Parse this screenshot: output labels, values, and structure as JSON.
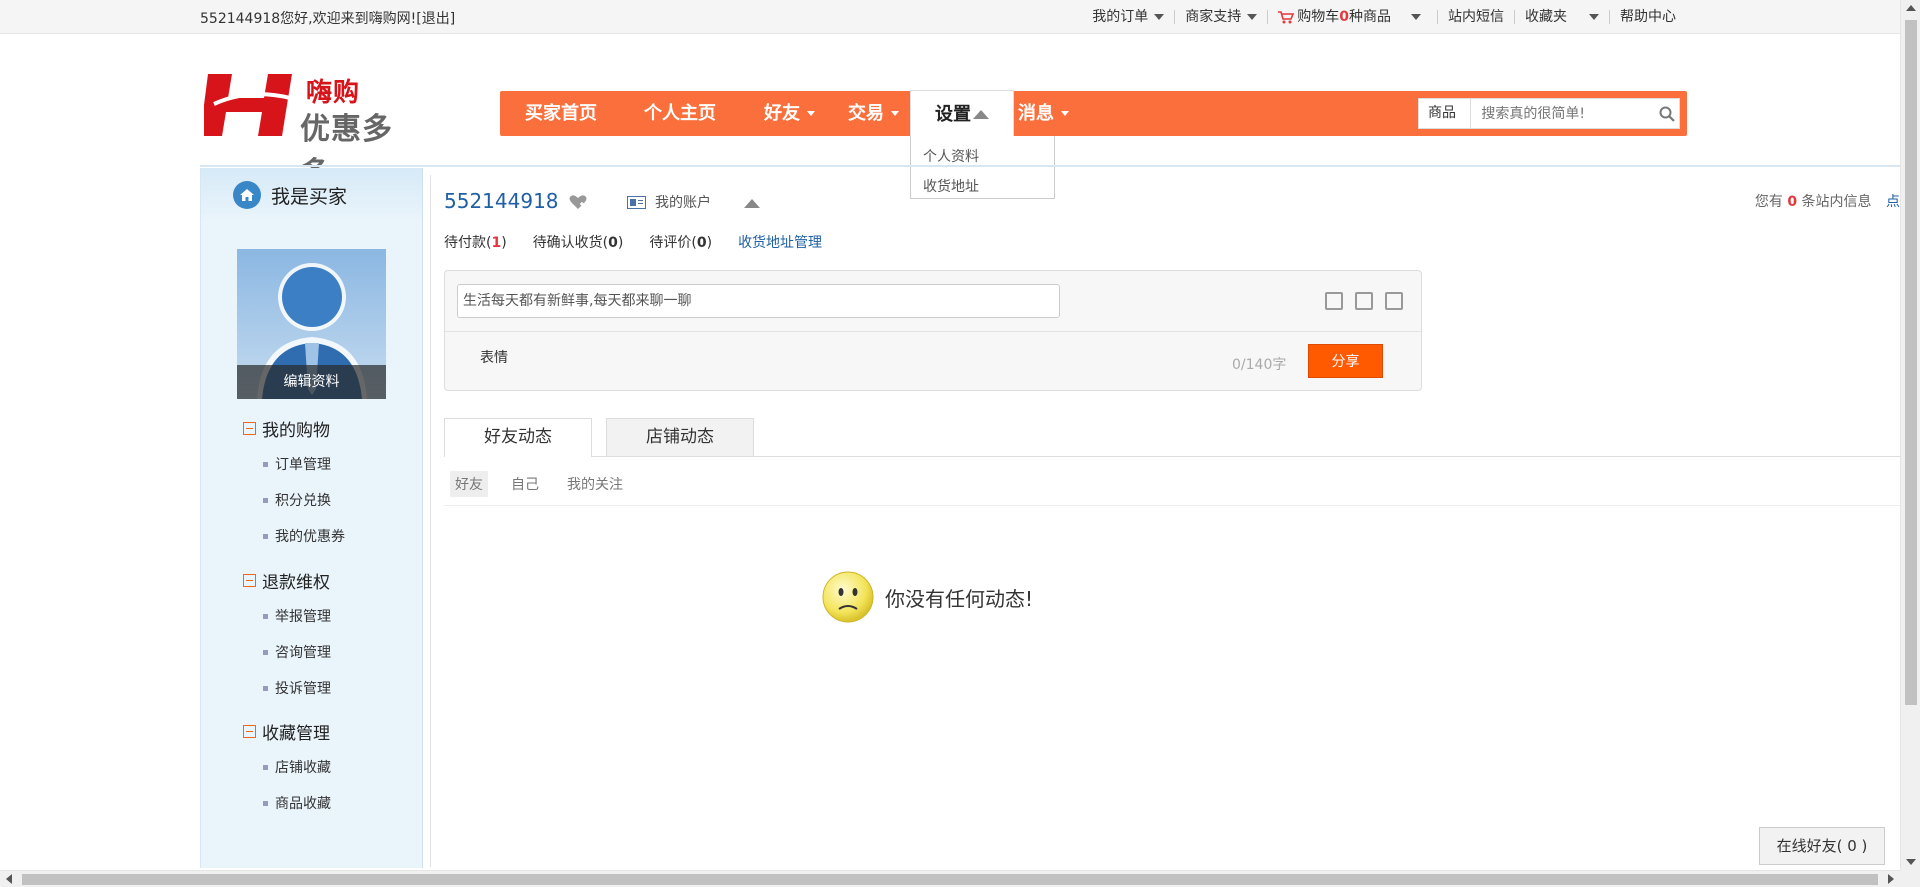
{
  "topbar": {
    "welcome": "552144918您好,欢迎来到嗨购网!",
    "logout": "[退出]",
    "my_orders": "我的订单",
    "seller_support": "商家支持",
    "cart_prefix": "购物车",
    "cart_count": "0",
    "cart_suffix": "种商品",
    "site_msg": "站内短信",
    "favorites": "收藏夹",
    "help": "帮助中心"
  },
  "logo": {
    "brand": "嗨购",
    "slogan": "优惠多多"
  },
  "nav": {
    "items": [
      "买家首页",
      "个人主页",
      "好友",
      "交易",
      "设置",
      "消息"
    ],
    "dropdown": [
      "个人资料",
      "收货地址"
    ]
  },
  "search": {
    "category": "商品",
    "placeholder": "搜索真的很简单!"
  },
  "sidebar": {
    "title": "我是买家",
    "edit_profile": "编辑资料",
    "groups": [
      {
        "title": "我的购物",
        "items": [
          "订单管理",
          "积分兑换",
          "我的优惠券"
        ]
      },
      {
        "title": "退款维权",
        "items": [
          "举报管理",
          "咨询管理",
          "投诉管理"
        ]
      },
      {
        "title": "收藏管理",
        "items": [
          "店铺收藏",
          "商品收藏"
        ]
      }
    ]
  },
  "main": {
    "username": "552144918",
    "my_account": "我的账户",
    "msgs_prefix": "您有",
    "msgs_count": "0",
    "msgs_suffix": "条站内信息",
    "msgs_link": "点",
    "status": {
      "pending_pay_label": "待付款(",
      "pending_pay_count": "1",
      "pending_confirm_label": "待确认收货(",
      "pending_confirm_count": "0",
      "pending_review_label": "待评价(",
      "pending_review_count": "0",
      "close": ")",
      "address_manage": "收货地址管理"
    },
    "composer": {
      "placeholder": "生活每天都有新鲜事,每天都来聊一聊",
      "emoji": "表情",
      "count": "0/140字",
      "share": "分享"
    },
    "tabs": [
      "好友动态",
      "店铺动态"
    ],
    "filters": [
      "好友",
      "自己",
      "我的关注"
    ],
    "empty_text": "你没有任何动态!"
  },
  "online_friends": "在线好友( 0 )",
  "colors": {
    "nav_orange": "#fa6f3c",
    "share_orange": "#ff5a00",
    "link_blue": "#1e5fa5",
    "logo_red": "#d7141a"
  }
}
